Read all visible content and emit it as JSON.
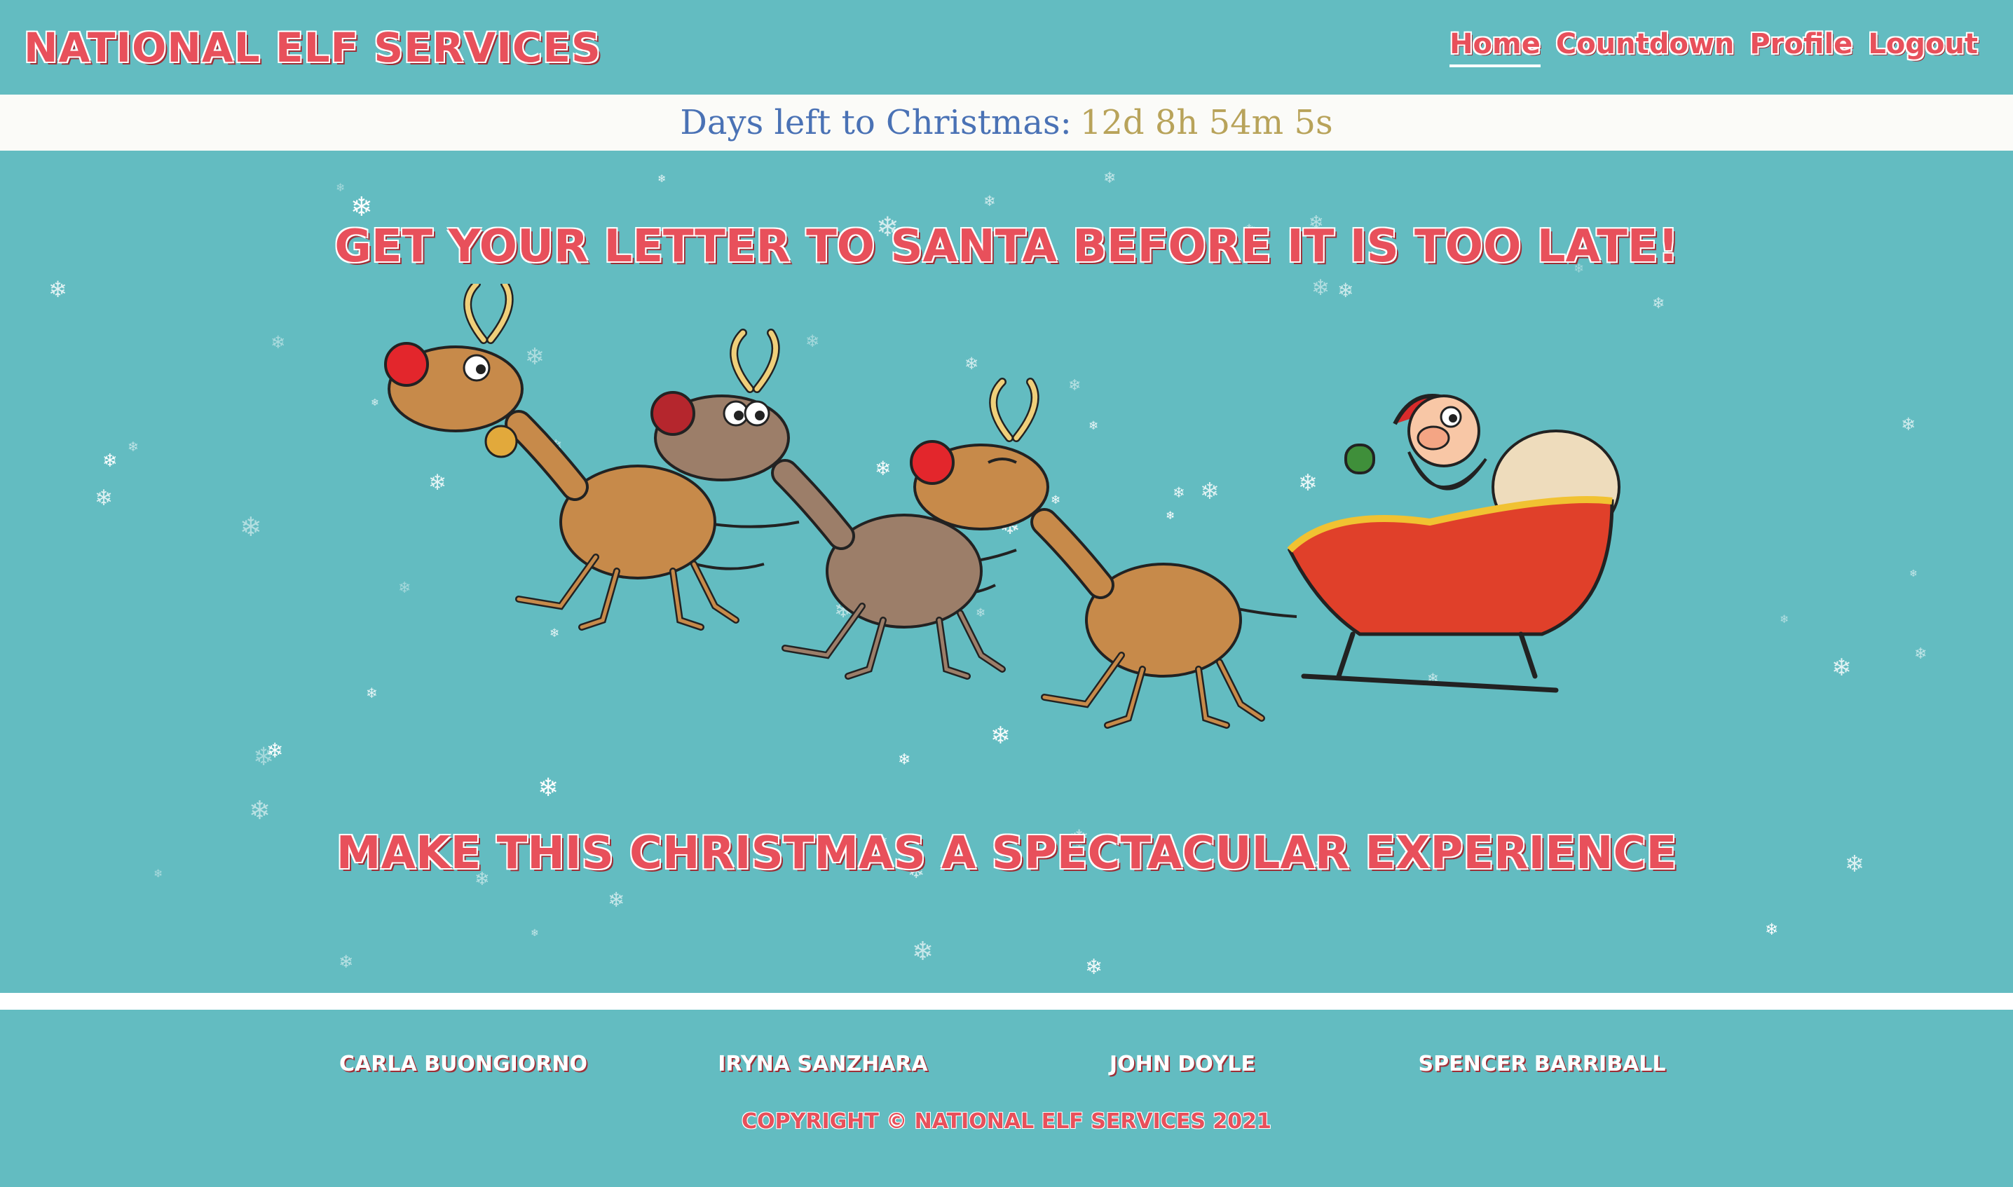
{
  "header": {
    "brand": "National Elf Services",
    "nav": [
      {
        "label": "Home",
        "active": true
      },
      {
        "label": "Countdown",
        "active": false
      },
      {
        "label": "Profile",
        "active": false
      },
      {
        "label": "Logout",
        "active": false
      }
    ]
  },
  "countdown": {
    "label": "Days left to Christmas:",
    "value": "12d 8h 54m 5s"
  },
  "hero": {
    "headline_top": "Get your letter to Santa before it is too late!",
    "headline_bottom": "Make this Christmas a spectacular experience",
    "illustration": "santa-sleigh-reindeer"
  },
  "footer": {
    "authors": [
      "Carla Buongiorno",
      "Iryna Sanzhara",
      "John Doyle",
      "Spencer Barriball"
    ],
    "copyright": "Copyright © National Elf Services 2021"
  },
  "colors": {
    "background": "#63bcc1",
    "accent": "#e8505b",
    "countdown_bar": "#fbfbf8"
  }
}
